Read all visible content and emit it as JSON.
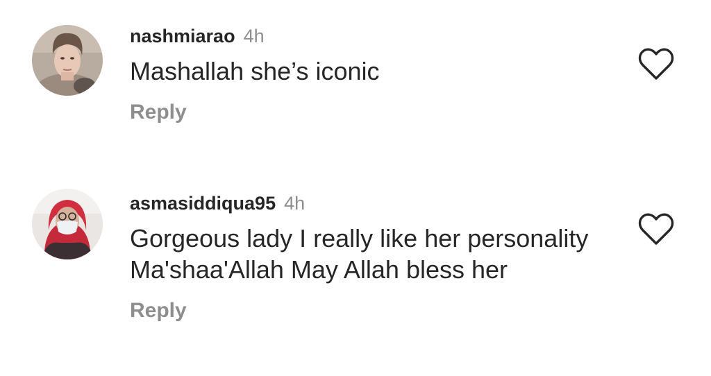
{
  "comments": [
    {
      "username": "nashmiarao",
      "time": "4h",
      "text": "Mashallah she’s iconic",
      "reply_label": "Reply",
      "like_icon": "heart-outline-icon",
      "avatar_icon": "avatar-photo"
    },
    {
      "username": "asmasiddiqua95",
      "time": "4h",
      "text": "Gorgeous lady I really like her personality Ma'shaa'Allah May Allah bless her",
      "reply_label": "Reply",
      "like_icon": "heart-outline-icon",
      "avatar_icon": "avatar-photo"
    }
  ],
  "colors": {
    "text_primary": "#262626",
    "text_secondary": "#8e8e8e",
    "background": "#ffffff"
  }
}
